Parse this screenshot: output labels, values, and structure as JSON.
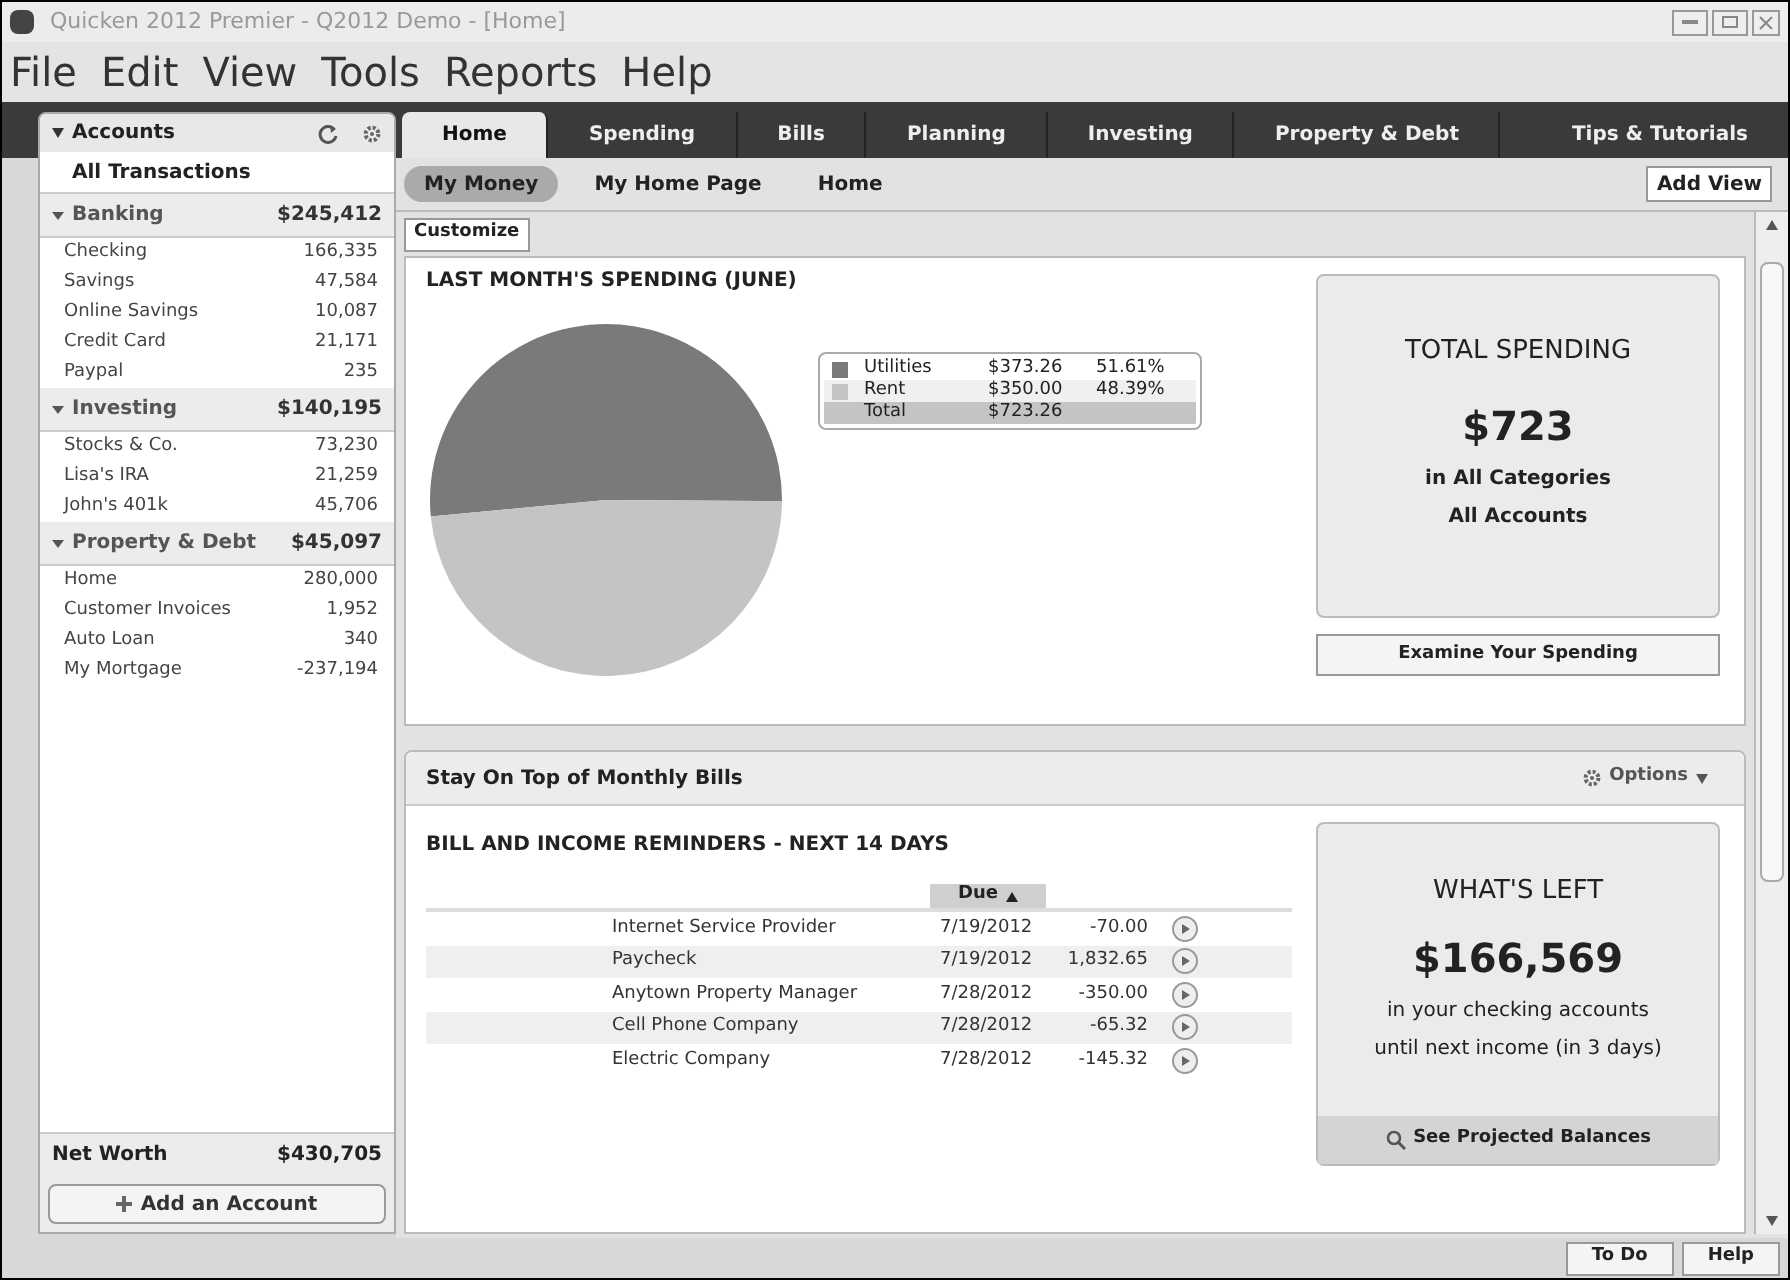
{
  "window": {
    "title": "Quicken 2012 Premier - Q2012 Demo - [Home]"
  },
  "menu": [
    "File",
    "Edit",
    "View",
    "Tools",
    "Reports",
    "Help"
  ],
  "sidebar": {
    "title": "Accounts",
    "all_transactions": "All Transactions",
    "groups": [
      {
        "name": "Banking",
        "total": "$245,412",
        "expanded": true,
        "accounts": [
          {
            "name": "Checking",
            "balance": "166,335"
          },
          {
            "name": "Savings",
            "balance": "47,584"
          },
          {
            "name": "Online Savings",
            "balance": "10,087"
          },
          {
            "name": "Credit Card",
            "balance": "21,171"
          },
          {
            "name": "Paypal",
            "balance": "235"
          }
        ]
      },
      {
        "name": "Investing",
        "total": "$140,195",
        "expanded": true,
        "accounts": [
          {
            "name": "Stocks & Co.",
            "balance": "73,230"
          },
          {
            "name": "Lisa's IRA",
            "balance": "21,259"
          },
          {
            "name": "John's 401k",
            "balance": "45,706"
          }
        ]
      },
      {
        "name": "Property & Debt",
        "total": "$45,097",
        "expanded": true,
        "accounts": [
          {
            "name": "Home",
            "balance": "280,000"
          },
          {
            "name": "Customer Invoices",
            "balance": "1,952"
          },
          {
            "name": "Auto Loan",
            "balance": "340"
          },
          {
            "name": "My Mortgage",
            "balance": "-237,194"
          }
        ]
      }
    ],
    "net_worth": {
      "label": "Net Worth",
      "value": "$430,705"
    },
    "add_button": "Add an Account"
  },
  "tabs": [
    {
      "label": "Home",
      "selected": true
    },
    {
      "label": "Spending",
      "selected": false
    },
    {
      "label": "Bills",
      "selected": false
    },
    {
      "label": "Planning",
      "selected": false
    },
    {
      "label": "Investing",
      "selected": false
    },
    {
      "label": "Property & Debt",
      "selected": false
    }
  ],
  "tips": "Tips & Tutorials",
  "subtabs": [
    {
      "label": "My Money",
      "selected": true
    },
    {
      "label": "My Home Page",
      "selected": false
    },
    {
      "label": "Home",
      "selected": false
    }
  ],
  "add_view": "Add View",
  "customize": "Customize",
  "spending": {
    "title": "LAST MONTH'S SPENDING (JUNE)",
    "chart_data": {
      "type": "pie",
      "categories": [
        "Utilities",
        "Rent"
      ],
      "series": [
        {
          "values": [
            51.61,
            48.39
          ]
        }
      ]
    },
    "legend": [
      {
        "amount": "$373.26",
        "percent": "51.61%",
        "color": "#7a7a7a"
      },
      {
        "amount": "$350.00",
        "percent": "48.39%",
        "color": "#c4c4c4"
      }
    ],
    "total": {
      "label": "Total",
      "amount": "$723.26"
    },
    "card": {
      "title": "TOTAL SPENDING",
      "amount": "$723",
      "lines": [
        "in All Categories",
        "All Accounts"
      ]
    },
    "button": "Examine Your Spending"
  },
  "bills": {
    "title": "Stay On Top of Monthly Bills",
    "options": "Options",
    "subtitle": "BILL AND INCOME REMINDERS - NEXT 14 DAYS",
    "column": "Due",
    "rows": [
      {
        "payee": "Internet Service Provider",
        "due": "7/19/2012",
        "amount": "-70.00"
      },
      {
        "payee": "Paycheck",
        "due": "7/19/2012",
        "amount": "1,832.65"
      },
      {
        "payee": "Anytown Property Manager",
        "due": "7/28/2012",
        "amount": "-350.00"
      },
      {
        "payee": "Cell Phone Company",
        "due": "7/28/2012",
        "amount": "-65.32"
      },
      {
        "payee": "Electric Company",
        "due": "7/28/2012",
        "amount": "-145.32"
      }
    ],
    "card": {
      "title": "WHAT'S LEFT",
      "amount": "$166,569",
      "lines": [
        "in your checking accounts",
        "until next income (in 3 days)"
      ],
      "button": "See Projected Balances"
    }
  },
  "footer": [
    "To Do",
    "Help"
  ]
}
